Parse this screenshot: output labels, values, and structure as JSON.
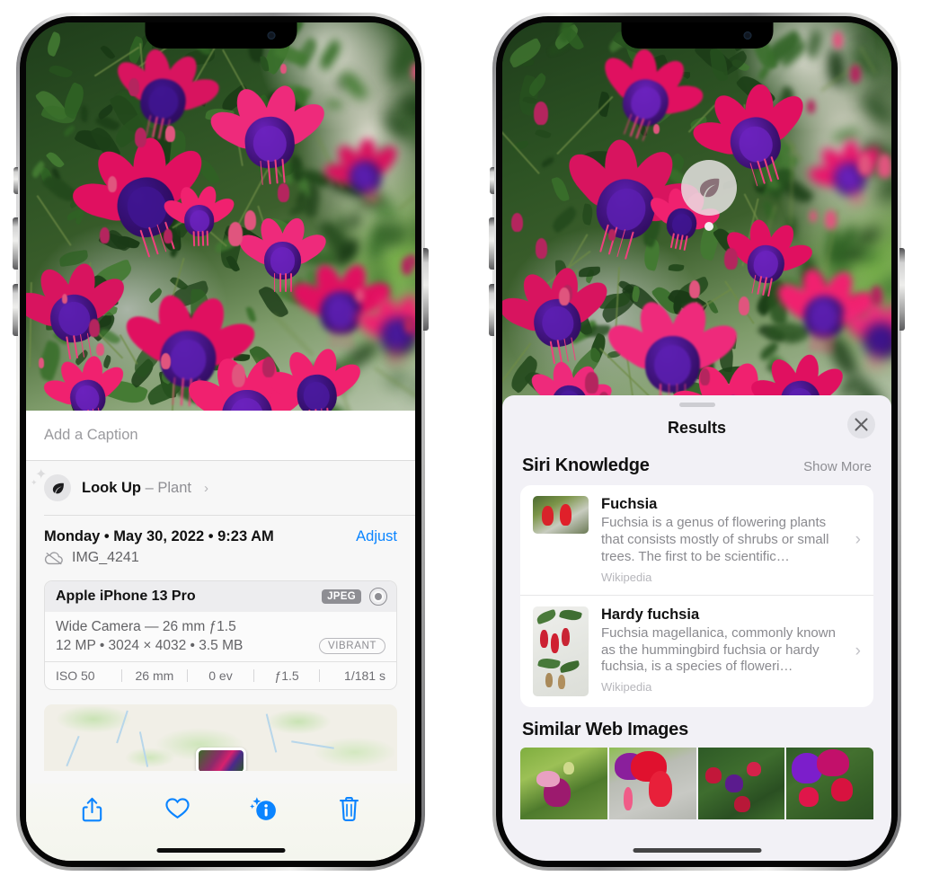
{
  "left_phone": {
    "name": "iPhone showing Photos info panel",
    "caption_field": {
      "placeholder": "Add a Caption",
      "value": ""
    },
    "look_up_row": {
      "icon": "leaf-icon",
      "sparkle_icon": "sparkle-icon",
      "label": "Look Up",
      "dash": "–",
      "subject": "Plant",
      "chevron": "›"
    },
    "date_row": {
      "date": "Monday • May 30, 2022 • 9:23 AM",
      "adjust_label": "Adjust"
    },
    "file_row": {
      "icon": "icloud-slash-icon",
      "filename": "IMG_4241"
    },
    "camera_card": {
      "model": "Apple iPhone 13 Pro",
      "format_badge": "JPEG",
      "raw_icon": "raw-circle-icon",
      "lens_line": "Wide Camera — 26 mm ƒ1.5",
      "specs_line": "12 MP • 3024 × 4032 • 3.5 MB",
      "style_badge": "VIBRANT",
      "exif": [
        "ISO 50",
        "26 mm",
        "0 ev",
        "ƒ1.5",
        "1/181 s"
      ]
    },
    "map_card": {
      "pin": "photo-thumbnail-pin"
    },
    "toolbar": [
      {
        "name": "share-button",
        "icon": "share-icon"
      },
      {
        "name": "favorite-button",
        "icon": "heart-icon"
      },
      {
        "name": "info-button",
        "icon": "info-sparkle-icon"
      },
      {
        "name": "delete-button",
        "icon": "trash-icon"
      }
    ]
  },
  "right_phone": {
    "name": "iPhone showing Visual Look Up results",
    "visual_lookup_badge": {
      "icon": "leaf-icon"
    },
    "sheet": {
      "title": "Results",
      "close_icon": "close-icon",
      "grabber": "sheet-grabber",
      "siri_knowledge": {
        "heading": "Siri Knowledge",
        "show_more": "Show More",
        "items": [
          {
            "title": "Fuchsia",
            "description": "Fuchsia is a genus of flowering plants that consists mostly of shrubs or small trees. The first to be scientific…",
            "source": "Wikipedia",
            "chevron": "›"
          },
          {
            "title": "Hardy fuchsia",
            "description": "Fuchsia magellanica, commonly known as the hummingbird fuchsia or hardy fuchsia, is a species of floweri…",
            "source": "Wikipedia",
            "chevron": "›"
          }
        ]
      },
      "similar_web_images": {
        "heading": "Similar Web Images",
        "count": 4
      }
    }
  },
  "colors": {
    "accent_blue": "#0a84ff",
    "sheet_bg": "#f2f1f6",
    "panel_bg": "#f7f7f7",
    "secondary_text": "#8e8e93"
  }
}
